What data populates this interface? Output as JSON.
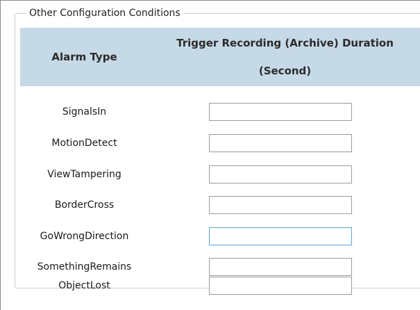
{
  "section": {
    "legend": "Other Configuration Conditions"
  },
  "table": {
    "headers": {
      "alarm_type": "Alarm Type",
      "duration_line1": "Trigger Recording (Archive) Duration",
      "duration_line2": "(Second)"
    },
    "rows": [
      {
        "alarm_type": "SignalsIn",
        "duration": ""
      },
      {
        "alarm_type": "MotionDetect",
        "duration": ""
      },
      {
        "alarm_type": "ViewTampering",
        "duration": ""
      },
      {
        "alarm_type": "BorderCross",
        "duration": ""
      },
      {
        "alarm_type": "GoWrongDirection",
        "duration": ""
      },
      {
        "alarm_type": "SomethingRemains",
        "duration": ""
      },
      {
        "alarm_type": "ObjectLost",
        "duration": ""
      }
    ]
  },
  "colors": {
    "header_background": "#c6d9e6",
    "focused_input_border": "#5aa6d6"
  }
}
